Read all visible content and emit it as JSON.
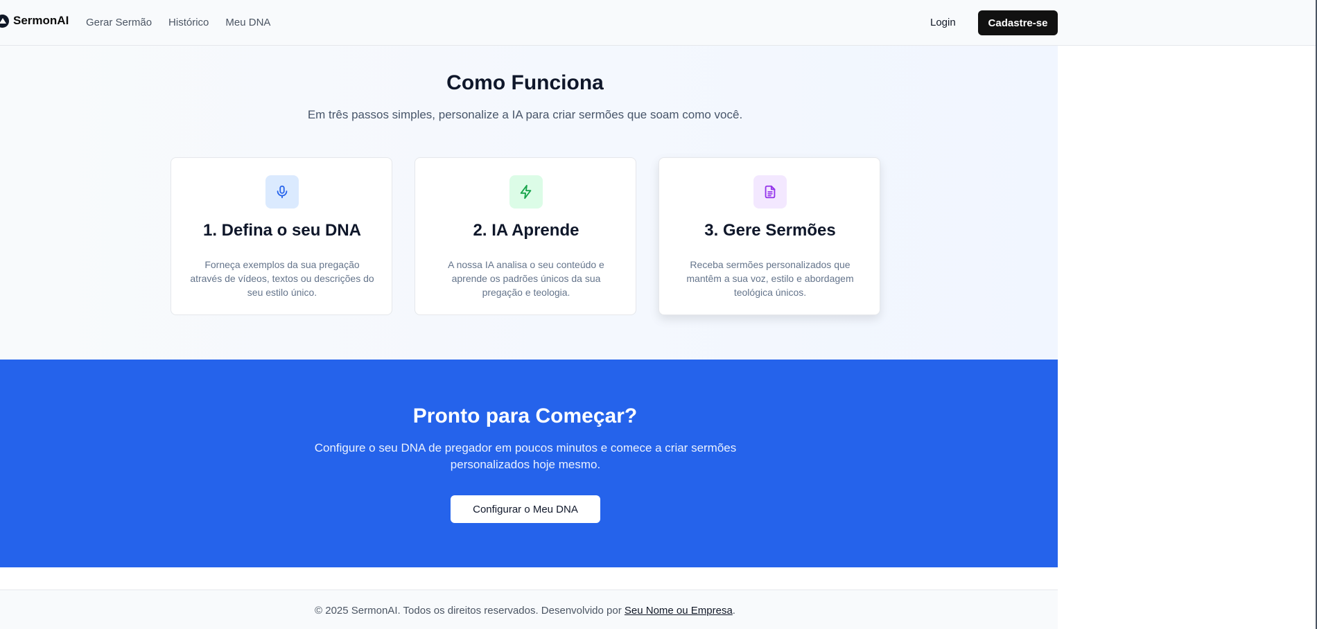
{
  "brand": {
    "name": "SermonAI"
  },
  "nav": {
    "items": [
      {
        "label": "Gerar Sermão"
      },
      {
        "label": "Histórico"
      },
      {
        "label": "Meu DNA"
      }
    ]
  },
  "header_actions": {
    "login_label": "Login",
    "signup_label": "Cadastre-se"
  },
  "how_it_works": {
    "title": "Como Funciona",
    "subtitle": "Em três passos simples, personalize a IA para criar sermões que soam como você.",
    "cards": [
      {
        "icon": "microphone-icon",
        "title": "1. Defina o seu DNA",
        "text": "Forneça exemplos da sua pregação através de vídeos, textos ou descrições do seu estilo único."
      },
      {
        "icon": "lightning-icon",
        "title": "2. IA Aprende",
        "text": "A nossa IA analisa o seu conteúdo e aprende os padrões únicos da sua pregação e teologia."
      },
      {
        "icon": "document-icon",
        "title": "3. Gere Sermões",
        "text": "Receba sermões personalizados que mantêm a sua voz, estilo e abordagem teológica únicos."
      }
    ]
  },
  "cta": {
    "title": "Pronto para Começar?",
    "text": "Configure o seu DNA de pregador em poucos minutos e comece a criar sermões personalizados hoje mesmo.",
    "button_label": "Configurar o Meu DNA"
  },
  "footer": {
    "prefix": "© 2025 SermonAI. Todos os direitos reservados. Desenvolvido por ",
    "link_label": "Seu Nome ou Empresa",
    "suffix": "."
  },
  "colors": {
    "accent_blue": "#2563eb",
    "dark_button": "#111111"
  }
}
